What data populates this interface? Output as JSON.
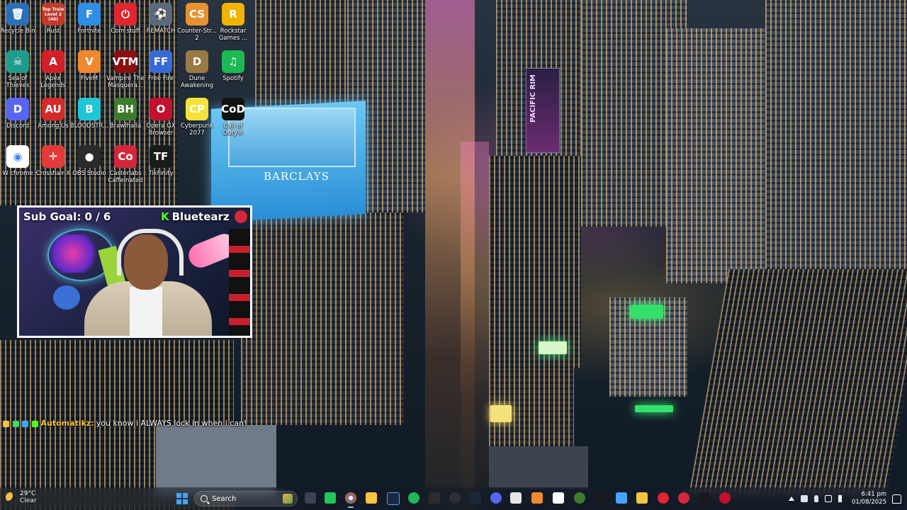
{
  "desktop": {
    "icons": [
      {
        "label": "Recycle Bin",
        "glyph": "🗑",
        "color": "#2b6fb8"
      },
      {
        "label": "Rust",
        "glyph": "Top Train Level 2 (40)",
        "color": "#c0392b"
      },
      {
        "label": "Fortnite",
        "glyph": "F",
        "color": "#2f8fe6"
      },
      {
        "label": "Corn stuff",
        "glyph": "⏻",
        "color": "#e0262e"
      },
      {
        "label": "REMATCH",
        "glyph": "⚽",
        "color": "#5a6a7c"
      },
      {
        "label": "Counter-Str... 2",
        "glyph": "CS",
        "color": "#e8912f"
      },
      {
        "label": "Rockstar Games ...",
        "glyph": "R",
        "color": "#f0b400"
      },
      {
        "label": "Sea of Thieves",
        "glyph": "☠",
        "color": "#1e9c8c"
      },
      {
        "label": "Apex Legends",
        "glyph": "A",
        "color": "#d21f2a"
      },
      {
        "label": "FiveM",
        "glyph": "V",
        "color": "#f0882f"
      },
      {
        "label": "Vampire The Masquera...",
        "glyph": "VTM",
        "color": "#8a0f12"
      },
      {
        "label": "Free Fire",
        "glyph": "FF",
        "color": "#3a6ad6"
      },
      {
        "label": "Dune Awakening",
        "glyph": "D",
        "color": "#9a7a44"
      },
      {
        "label": "Spotify",
        "glyph": "♫",
        "color": "#1db954"
      },
      {
        "label": "Discord",
        "glyph": "D",
        "color": "#5865f2"
      },
      {
        "label": "Among Us",
        "glyph": "AU",
        "color": "#d42a2a"
      },
      {
        "label": "BLOODSTR...",
        "glyph": "B",
        "color": "#1ec7d6"
      },
      {
        "label": "Brawlhalla",
        "glyph": "BH",
        "color": "#3f7b2c"
      },
      {
        "label": "Opera GX Browser",
        "glyph": "O",
        "color": "#c4102c"
      },
      {
        "label": "Cyberpunk 2077",
        "glyph": "CP",
        "color": "#f4e23a"
      },
      {
        "label": "Call of Duty®",
        "glyph": "CoD",
        "color": "#111111"
      },
      {
        "label": "W chrome",
        "glyph": "◉",
        "color": "#ffffff"
      },
      {
        "label": "Crosshair X",
        "glyph": "✛",
        "color": "#e23a3a"
      },
      {
        "label": "OBS Studio",
        "glyph": "●",
        "color": "#2a2a2a"
      },
      {
        "label": "Casterlabs Caffeinated",
        "glyph": "Co",
        "color": "#d4263a"
      },
      {
        "label": "TikFinity",
        "glyph": "TF",
        "color": "#1a1a1a"
      }
    ]
  },
  "wallpaper": {
    "building_sign": "BARCLAYS",
    "billboard": "PACIFIC RIM"
  },
  "webcam": {
    "sub_goal": "Sub Goal: 0 / 6",
    "kick_letter": "K",
    "streamer": "Bluetearz"
  },
  "chat": {
    "username": "Automatikz:",
    "message": "you know i ALWAYS lock in when i can!"
  },
  "taskbar": {
    "weather_temp": "29°C",
    "weather_cond": "Clear",
    "search_placeholder": "Search",
    "time": "6:41 pm",
    "date": "01/08/2025"
  }
}
